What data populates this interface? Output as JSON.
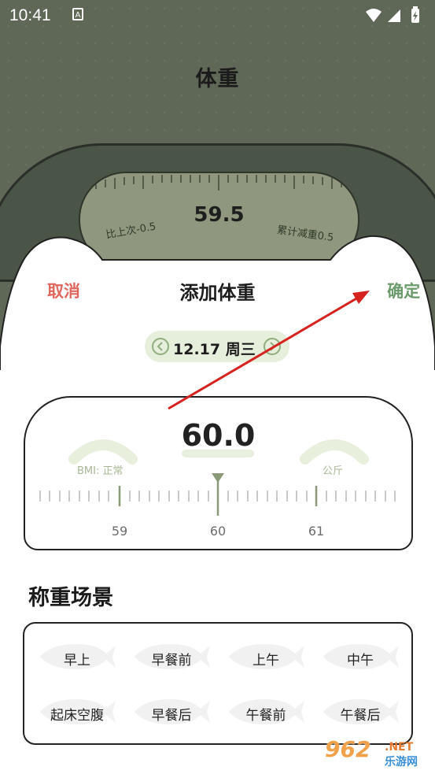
{
  "status_bar": {
    "time": "10:41",
    "notification_icon": "A"
  },
  "background_page": {
    "title": "体重",
    "scale": {
      "value": "59.5",
      "left_note": "比上次-0.5",
      "right_note": "累计减重0.5"
    }
  },
  "dialog": {
    "cancel_label": "取消",
    "title": "添加体重",
    "confirm_label": "确定",
    "date": "12.17 周三",
    "weight": {
      "value": "60.0",
      "bmi_label": "BMI: 正常",
      "unit_label": "公斤",
      "ruler_labels": [
        "59",
        "60",
        "61"
      ]
    }
  },
  "scene": {
    "title": "称重场景",
    "options": [
      "早上",
      "早餐前",
      "上午",
      "中午",
      "起床空腹",
      "早餐后",
      "午餐前",
      "午餐后"
    ]
  },
  "watermark": {
    "number": "962",
    "net": ".NET",
    "text": "乐游网"
  },
  "colors": {
    "accent_green": "#6b9a6b",
    "cancel_red": "#e0675e",
    "pill_bg": "#e6eedc",
    "annotation_arrow": "#d6231f"
  }
}
